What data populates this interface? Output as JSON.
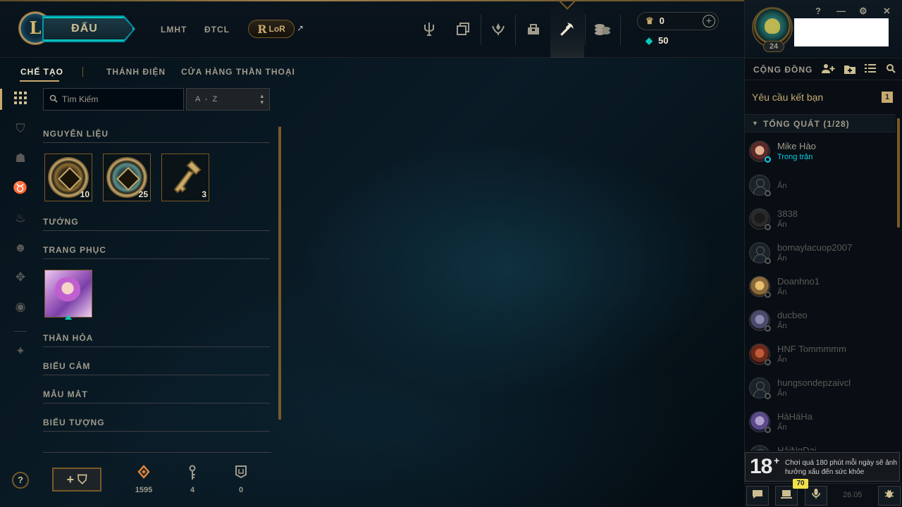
{
  "topbar": {
    "logo_letter": "L",
    "play_label": "ĐẤU",
    "nav_links": [
      "LMHT",
      "ĐTCL"
    ],
    "lor_letter": "R",
    "lor_label": "LoR",
    "ext_icon": "↗",
    "nav_icons": [
      "trident-icon",
      "collection-icon",
      "rewards-icon",
      "inventory-icon",
      "loot-icon",
      "store-icon"
    ],
    "currency": {
      "rp": "0",
      "blue_essence": "50",
      "plus": "+"
    }
  },
  "profile": {
    "level": "24"
  },
  "window": {
    "help": "?",
    "minimize": "—",
    "settings": "⚙",
    "close": "✕"
  },
  "social": {
    "title": "CỘNG ĐỒNG",
    "friend_requests_label": "Yêu cầu kết bạn",
    "friend_requests_count": "1",
    "group_label": "TỔNG QUÁT (1/28)",
    "friends": [
      {
        "name": "Mike Hào",
        "status": "Trong trận",
        "online": true
      },
      {
        "name": "",
        "status": "Ẩn",
        "online": false
      },
      {
        "name": "3838",
        "status": "Ẩn",
        "online": false
      },
      {
        "name": "bomaylacuop2007",
        "status": "Ẩn",
        "online": false
      },
      {
        "name": "Doanhno1",
        "status": "Ẩn",
        "online": false
      },
      {
        "name": "ducbeo",
        "status": "Ẩn",
        "online": false
      },
      {
        "name": "HNF Tommmmm",
        "status": "Ẩn",
        "online": false
      },
      {
        "name": "hungsondepzaivcl",
        "status": "Ẩn",
        "online": false
      },
      {
        "name": "HàHáHa",
        "status": "Ẩn",
        "online": false
      },
      {
        "name": "HảiNgDai",
        "status": "",
        "online": false
      }
    ],
    "age_rating": "18",
    "age_plus": "+",
    "age_warning": "Chơi quá 180 phút mỗi ngày sẽ ảnh hưởng xấu đến sức khỏe",
    "footer_badge": "70",
    "version": "26.05"
  },
  "loot": {
    "tabs": [
      "CHẾ TẠO",
      "THÁNH ĐIỆN",
      "CỬA HÀNG THẦN THOẠI"
    ],
    "search_placeholder": "Tìm Kiếm",
    "sort_value": "A - Z",
    "categories": {
      "materials": "NGUYÊN LIỆU",
      "champions": "TƯỚNG",
      "skins": "TRANG PHỤC",
      "wards": "THẦN HỎA",
      "emotes": "BIỂU CẢM",
      "eyes": "MẪU MẮT",
      "icons": "BIỂU TƯỢNG"
    },
    "materials": [
      {
        "icon": "chest-icon",
        "qty": "10"
      },
      {
        "icon": "masterwork-chest-icon",
        "qty": "25"
      },
      {
        "icon": "key-icon",
        "qty": "3"
      }
    ],
    "help": "?",
    "add_chest": "+ ⛉",
    "stats": [
      {
        "icon": "orange-essence-icon",
        "value": "1595",
        "color": "#e0823c"
      },
      {
        "icon": "key-fragment-icon",
        "value": "4",
        "color": "#a09b8c"
      },
      {
        "icon": "chest-outline-icon",
        "value": "0",
        "color": "#a09b8c"
      }
    ]
  }
}
